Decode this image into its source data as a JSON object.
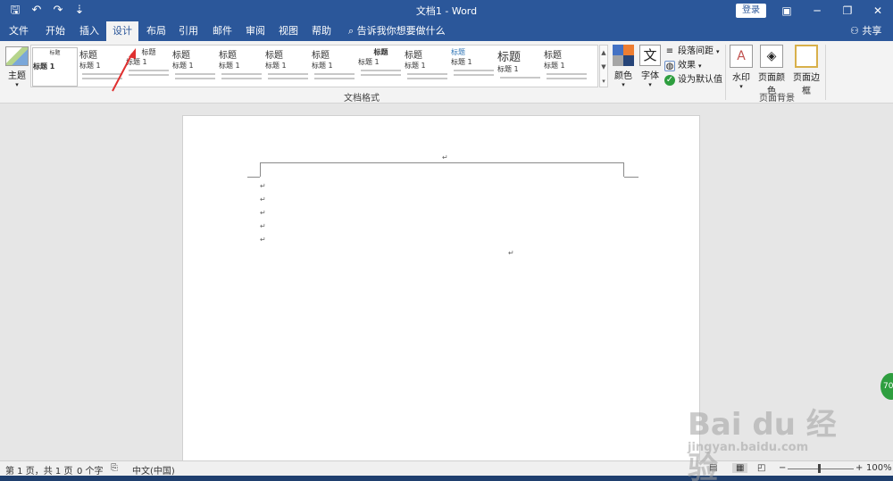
{
  "titlebar": {
    "title": "文档1 - Word",
    "login_label": "登录",
    "qat": {
      "save": "🖫",
      "undo": "↶",
      "redo": "↷",
      "customize": "⇣"
    },
    "window": {
      "ribbon_options": "▣",
      "minimize": "─",
      "restore": "❐",
      "close": "✕"
    }
  },
  "tabs": [
    {
      "label": "文件"
    },
    {
      "label": "开始"
    },
    {
      "label": "插入"
    },
    {
      "label": "设计"
    },
    {
      "label": "布局"
    },
    {
      "label": "引用"
    },
    {
      "label": "邮件"
    },
    {
      "label": "审阅"
    },
    {
      "label": "视图"
    },
    {
      "label": "帮助"
    }
  ],
  "tellme": "告诉我你想要做什么",
  "share": "共享",
  "ribbon": {
    "theme_label": "主题",
    "styles": [
      {
        "title": "标题",
        "heading": "标题 1"
      },
      {
        "title": "标题",
        "heading": "标题 1"
      },
      {
        "title": "标题",
        "heading": "标题 1"
      },
      {
        "title": "标题",
        "heading": "标题 1"
      },
      {
        "title": "标题",
        "heading": "标题 1"
      },
      {
        "title": "标题",
        "heading": "标题 1"
      },
      {
        "title": "标题",
        "heading": "标题 1"
      },
      {
        "title": "标题",
        "heading": "标题 1"
      },
      {
        "title": "标题",
        "heading": "标题 1"
      },
      {
        "title": "标题",
        "heading": "标题 1"
      },
      {
        "title": "标题",
        "heading": "标题 1"
      },
      {
        "title": "标题",
        "heading": "标题 1"
      }
    ],
    "doc_format_label": "文档格式",
    "colors_label": "颜色",
    "fonts_label": "字体",
    "para_spacing_label": "段落间距",
    "effects_label": "效果",
    "set_default_label": "设为默认值",
    "watermark_label": "水印",
    "page_color_label": "页面颜色",
    "page_border_label": "页面边框",
    "page_bg_label": "页面背景",
    "colors": {
      "c1": "#4472c4",
      "c2": "#ed7d31",
      "c3": "#a5a5a5",
      "c4": "#264478"
    }
  },
  "status": {
    "page": "第 1 页，共 1 页",
    "words": "0 个字",
    "language": "中文(中国)",
    "zoom": "100%",
    "zoom_minus": "−",
    "zoom_plus": "+"
  },
  "watermark": {
    "brand": "Bai du 经验",
    "url": "jingyan.baidu.com"
  },
  "badge": "70",
  "para_mark": "↵"
}
